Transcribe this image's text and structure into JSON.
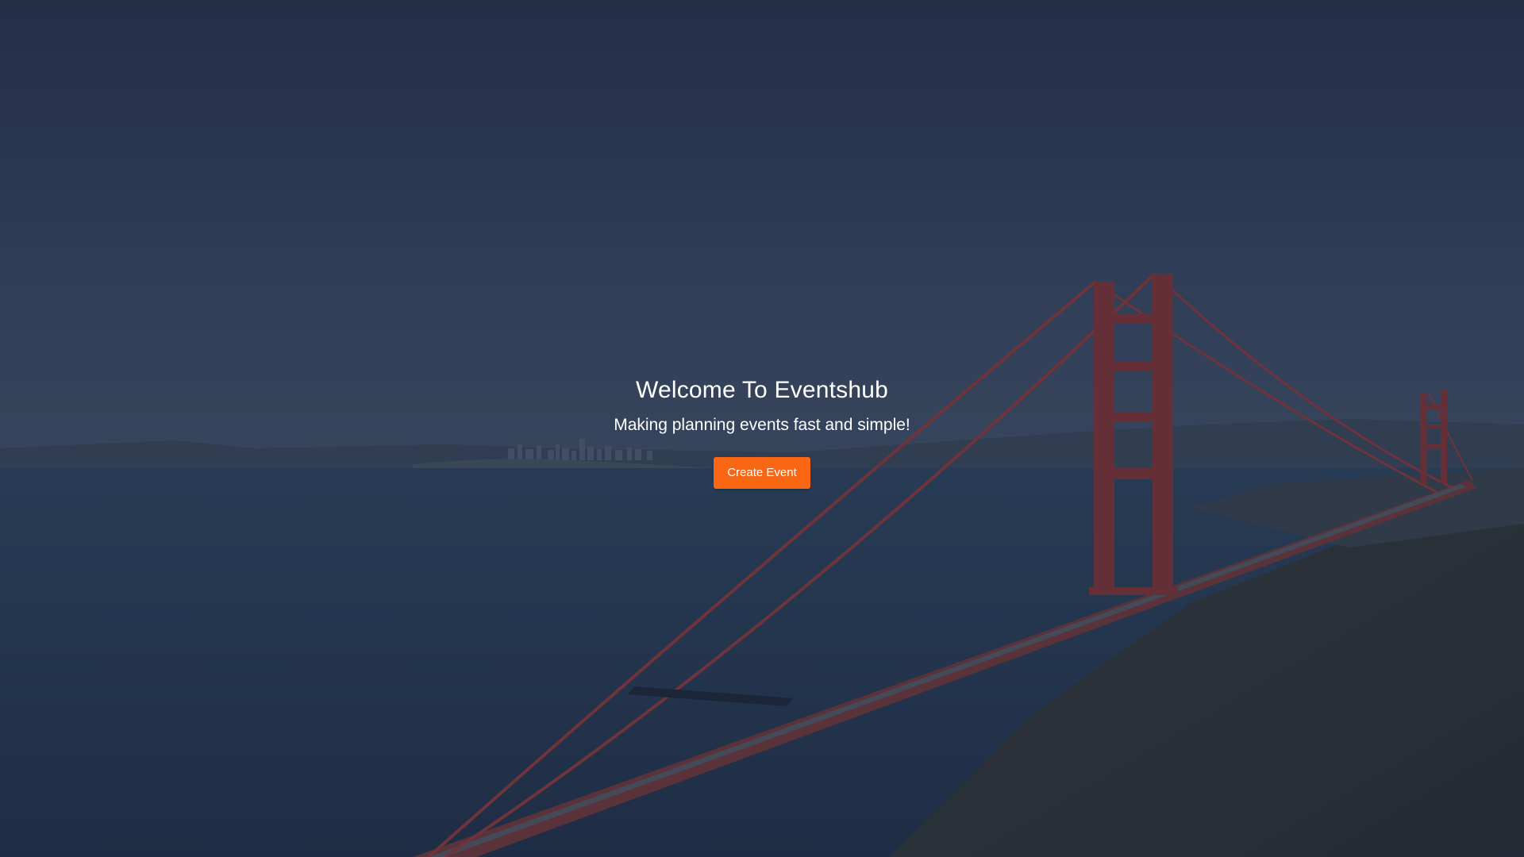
{
  "hero": {
    "background_image": "golden-gate-bridge-photo",
    "title": "Welcome To Eventshub",
    "subtitle": "Making planning events fast and simple!",
    "cta_label": "Create Event"
  },
  "colors": {
    "accent": "#f96614",
    "text": "#ffffff",
    "overlay": "#1e243c"
  }
}
